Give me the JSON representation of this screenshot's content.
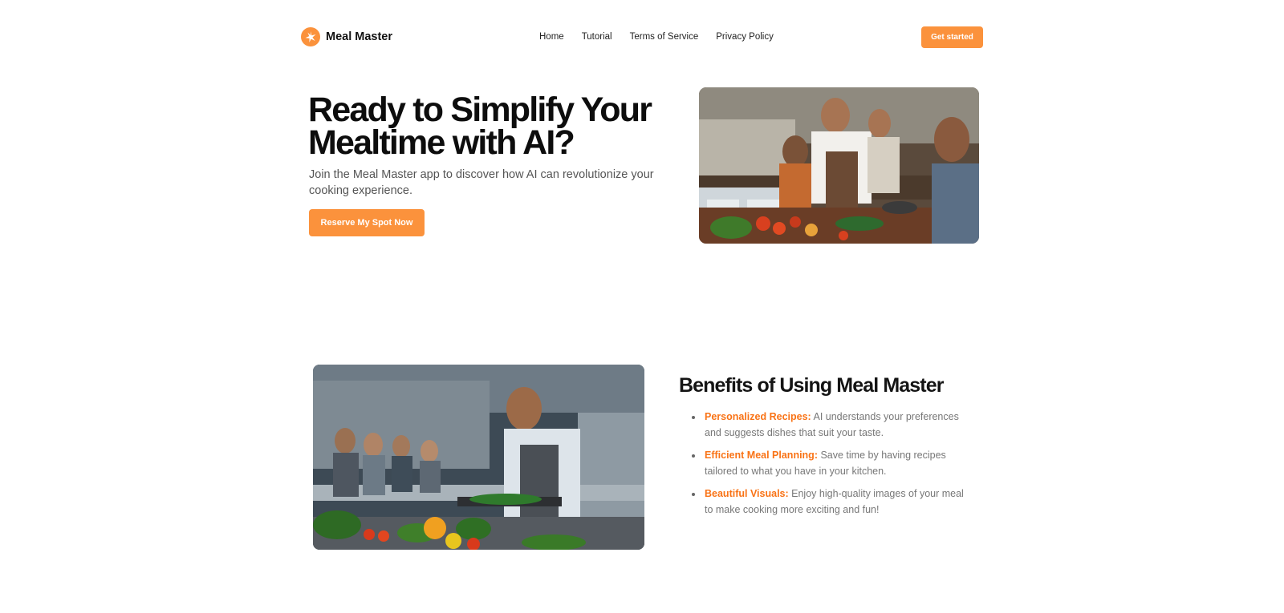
{
  "header": {
    "brand": "Meal Master",
    "nav": [
      "Home",
      "Tutorial",
      "Terms of Service",
      "Privacy Policy"
    ],
    "cta": "Get started"
  },
  "hero": {
    "title_line1": "Ready to Simplify Your",
    "title_line2": "Mealtime with AI?",
    "subtitle": "Join the Meal Master app to discover how AI can revolutionize your cooking experience.",
    "button": "Reserve My Spot Now"
  },
  "benefits": {
    "title": "Benefits of Using Meal Master",
    "items": [
      {
        "label": "Personalized Recipes:",
        "text": " AI understands your preferences and suggests dishes that suit your taste."
      },
      {
        "label": "Efficient Meal Planning:",
        "text": " Save time by having recipes tailored to what you have in your kitchen."
      },
      {
        "label": "Beautiful Visuals:",
        "text": " Enjoy high-quality images of your meal to make cooking more exciting and fun!"
      }
    ]
  },
  "colors": {
    "accent": "#fb923c",
    "highlight": "#f97316"
  },
  "icons": {
    "logo": "star-burst-logo-icon"
  }
}
